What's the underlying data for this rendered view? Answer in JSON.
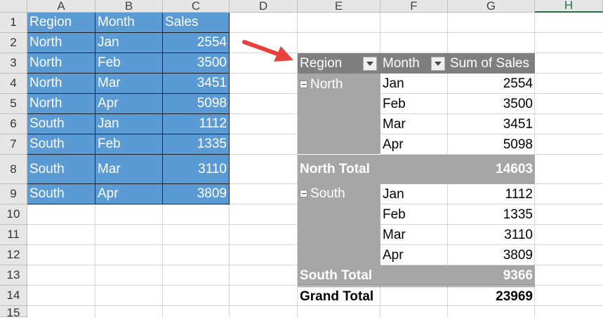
{
  "columns": [
    "A",
    "B",
    "C",
    "D",
    "E",
    "F",
    "G",
    "H"
  ],
  "rows": [
    "1",
    "2",
    "3",
    "4",
    "5",
    "6",
    "7",
    "8",
    "9",
    "10",
    "11",
    "12",
    "13",
    "14",
    "15"
  ],
  "source": {
    "headers": [
      "Region",
      "Month",
      "Sales"
    ],
    "data": [
      [
        "North",
        "Jan",
        "2554"
      ],
      [
        "North",
        "Feb",
        "3500"
      ],
      [
        "North",
        "Mar",
        "3451"
      ],
      [
        "North",
        "Apr",
        "5098"
      ],
      [
        "South",
        "Jan",
        "1112"
      ],
      [
        "South",
        "Feb",
        "1335"
      ],
      [
        "South",
        "Mar",
        "3110"
      ],
      [
        "South",
        "Apr",
        "3809"
      ]
    ]
  },
  "pivot": {
    "headers": [
      "Region",
      "Month",
      "Sum of Sales"
    ],
    "groups": [
      {
        "name": "North",
        "rows": [
          [
            "Jan",
            "2554"
          ],
          [
            "Feb",
            "3500"
          ],
          [
            "Mar",
            "3451"
          ],
          [
            "Apr",
            "5098"
          ]
        ],
        "total_label": "North Total",
        "total": "14603"
      },
      {
        "name": "South",
        "rows": [
          [
            "Jan",
            "1112"
          ],
          [
            "Feb",
            "1335"
          ],
          [
            "Mar",
            "3110"
          ],
          [
            "Apr",
            "3809"
          ]
        ],
        "total_label": "South Total",
        "total": "9366"
      }
    ],
    "grand_label": "Grand Total",
    "grand_total": "23969"
  },
  "colors": {
    "source_fill": "#5b9bd5",
    "pivot_header": "#7f7f7f",
    "pivot_grey": "#a6a6a6",
    "arrow": "#e8413c",
    "selected_header": "#217346"
  },
  "icons": [
    "filter-dropdown-icon",
    "collapse-minus-icon",
    "red-arrow-icon"
  ]
}
